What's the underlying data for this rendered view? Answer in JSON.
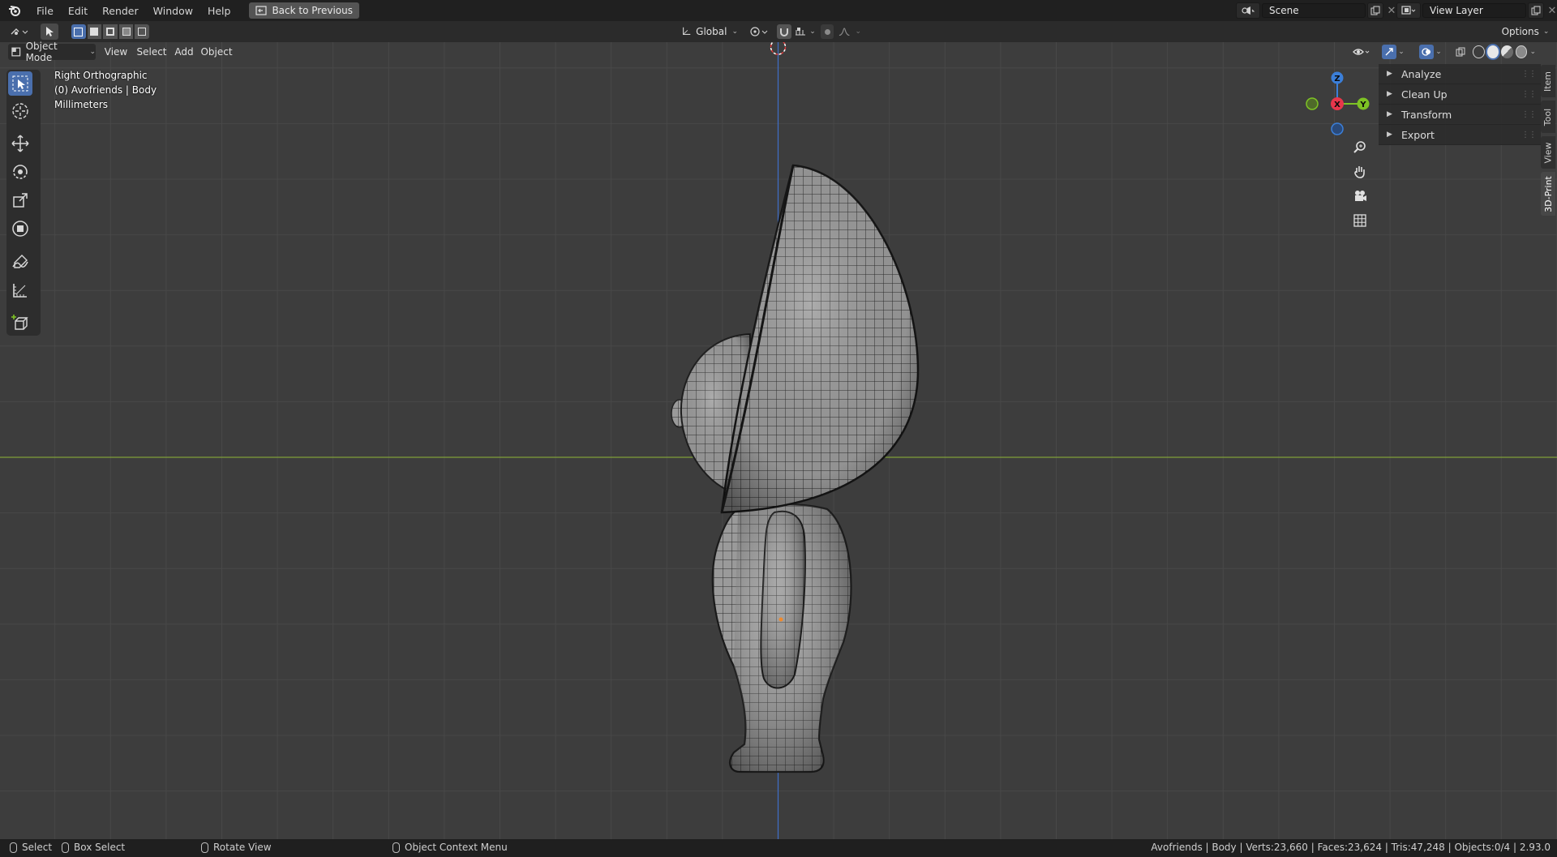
{
  "topbar": {
    "menus": [
      "File",
      "Edit",
      "Render",
      "Window",
      "Help"
    ],
    "back_button": "Back to Previous",
    "scene_name": "Scene",
    "view_layer_name": "View Layer"
  },
  "header": {
    "transform_orientation": "Global",
    "options_label": "Options"
  },
  "viewport_header": {
    "mode": "Object Mode",
    "menus": [
      "View",
      "Select",
      "Add",
      "Object"
    ]
  },
  "viewport_info": {
    "view_name": "Right Orthographic",
    "collection_object": "(0) Avofriends | Body",
    "units": "Millimeters"
  },
  "gizmo": {
    "z_label": "Z",
    "y_label": "Y",
    "x_label": "X",
    "x_color": "#e8364b",
    "y_color": "#7ec324",
    "z_color": "#3b7fd9"
  },
  "sidebar": {
    "panels": [
      "Analyze",
      "Clean Up",
      "Transform",
      "Export"
    ],
    "tabs": [
      "Item",
      "Tool",
      "View",
      "3D-Print"
    ],
    "active_tab": "3D-Print"
  },
  "statusbar": {
    "select": "Select",
    "box_select": "Box Select",
    "rotate_view": "Rotate View",
    "context_menu": "Object Context Menu",
    "stats": "Avofriends | Body | Verts:23,660 | Faces:23,624 | Tris:47,248 | Objects:0/4 | 2.93.0"
  },
  "colors": {
    "viewport_bg": "#3d3d3d",
    "grid_line": "#484848",
    "y_axis_line": "#7f9f3a",
    "z_axis_line": "#3f6ec9",
    "accent": "#4a6fad"
  }
}
